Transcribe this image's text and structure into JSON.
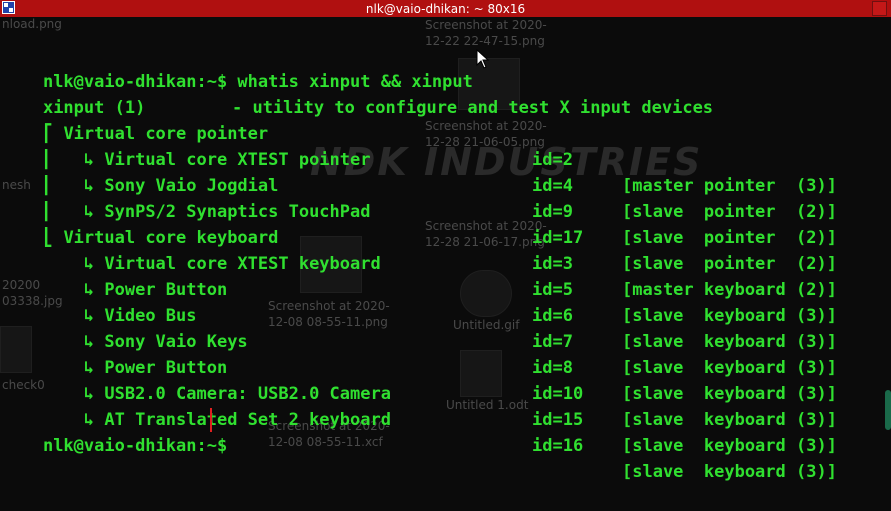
{
  "window": {
    "title": "nlk@vaio-dhikan: ~ 80x16"
  },
  "desktop": {
    "items": [
      {
        "label": "nload.png"
      },
      {
        "label": "Screenshot at 2020-\n12-22 22-47-15.png"
      },
      {
        "label": "Screenshot at 2020-\n12-28 21-06-05.png"
      },
      {
        "label": "Screenshot at 2020-\n12-28 21-06-17.png"
      },
      {
        "label": "Screenshot at 2020-\n12-08 08-55-11.png"
      },
      {
        "label": "Untitled.gif"
      },
      {
        "label": "Untitled 1.odt"
      },
      {
        "label": "Screenshot at 2020-\n12-08 08-55-11.xcf"
      },
      {
        "label": "nesh"
      },
      {
        "label": "20200"
      },
      {
        "label": "03338.jpg"
      },
      {
        "label": "check0"
      }
    ],
    "banner": "NDK INDUSTRIES"
  },
  "terminal": {
    "prompt": "nlk@vaio-dhikan:~$ ",
    "command": "whatis xinput && xinput",
    "whatis": {
      "name": "xinput (1)",
      "desc": "- utility to configure and test X input devices"
    },
    "devices": [
      {
        "tree": "⎡ ",
        "name": "Virtual core pointer",
        "id": "id=2",
        "role": "[master pointer  (3)]"
      },
      {
        "tree": "⎜   ↳ ",
        "name": "Virtual core XTEST pointer",
        "id": "id=4",
        "role": "[slave  pointer  (2)]"
      },
      {
        "tree": "⎜   ↳ ",
        "name": "Sony Vaio Jogdial",
        "id": "id=9",
        "role": "[slave  pointer  (2)]"
      },
      {
        "tree": "⎜   ↳ ",
        "name": "SynPS/2 Synaptics TouchPad",
        "id": "id=17",
        "role": "[slave  pointer  (2)]"
      },
      {
        "tree": "⎣ ",
        "name": "Virtual core keyboard",
        "id": "id=3",
        "role": "[master keyboard (2)]"
      },
      {
        "tree": "    ↳ ",
        "name": "Virtual core XTEST keyboard",
        "id": "id=5",
        "role": "[slave  keyboard (3)]"
      },
      {
        "tree": "    ↳ ",
        "name": "Power Button",
        "id": "id=6",
        "role": "[slave  keyboard (3)]"
      },
      {
        "tree": "    ↳ ",
        "name": "Video Bus",
        "id": "id=7",
        "role": "[slave  keyboard (3)]"
      },
      {
        "tree": "    ↳ ",
        "name": "Sony Vaio Keys",
        "id": "id=8",
        "role": "[slave  keyboard (3)]"
      },
      {
        "tree": "    ↳ ",
        "name": "Power Button",
        "id": "id=10",
        "role": "[slave  keyboard (3)]"
      },
      {
        "tree": "    ↳ ",
        "name": "USB2.0 Camera: USB2.0 Camera",
        "id": "id=15",
        "role": "[slave  keyboard (3)]"
      },
      {
        "tree": "    ↳ ",
        "name": "AT Translated Set 2 keyboard",
        "id": "id=16",
        "role": "[slave  keyboard (3)]"
      }
    ],
    "colors": {
      "text": "#30e030",
      "background": "#0b0b0b",
      "titlebar": "#b01010",
      "cursor": "#e02020"
    }
  }
}
